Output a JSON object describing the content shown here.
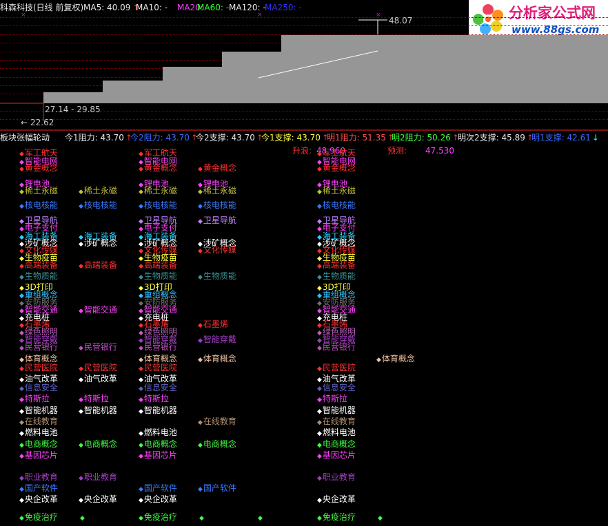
{
  "header": {
    "title": "科森科技(日线 前复权)",
    "items": [
      {
        "label": "MA5: 40.09",
        "color": "#e8e8e8",
        "arrow": "↑",
        "arrow_color": "#ff3333"
      },
      {
        "label": "MA10: -",
        "color": "#e8e8e8",
        "arrow": "",
        "arrow_color": ""
      },
      {
        "label": "MA20: -",
        "color": "#ff40ff",
        "arrow": "",
        "arrow_color": ""
      },
      {
        "label": "MA60: -",
        "color": "#30ff30",
        "arrow": "",
        "arrow_color": ""
      },
      {
        "label": "MA120: -",
        "color": "#e8e8e8",
        "arrow": "",
        "arrow_color": ""
      },
      {
        "label": "MA250: -",
        "color": "#3030ff",
        "arrow": "",
        "arrow_color": ""
      }
    ]
  },
  "logo": {
    "title": "分析家公式网",
    "url": "www.88gs.com"
  },
  "chart_labels": {
    "high": "48.07",
    "range": "27.14 - 29.85",
    "low": "22.62",
    "low_arrow": "←"
  },
  "indicator_bar": {
    "name": "板块张幅轮动",
    "items": [
      {
        "label": "今1阻力: 43.70",
        "color": "#e8e8e8",
        "arrow": "↑",
        "arrow_color": "#ff3333"
      },
      {
        "label": "今2阻力: 43.70",
        "color": "#3a6bff",
        "arrow": "↑",
        "arrow_color": "#ff3333"
      },
      {
        "label": "今2支撑: 43.70",
        "color": "#e8e8e8",
        "arrow": "↑",
        "arrow_color": "#ff3333"
      },
      {
        "label": "今1支撑: 43.70",
        "color": "#ffff40",
        "arrow": "↑",
        "arrow_color": "#ff3333"
      },
      {
        "label": "明1阻力: 51.35",
        "color": "#ff5050",
        "arrow": "↑",
        "arrow_color": "#ff3333"
      },
      {
        "label": "明2阻力: 50.26",
        "color": "#40ff40",
        "arrow": "↑",
        "arrow_color": "#ff3333"
      },
      {
        "label": "明次2支撑: 45.89",
        "color": "#e8e8e8",
        "arrow": "↑",
        "arrow_color": "#ff3333"
      },
      {
        "label": "明1支撑: 42.61",
        "color": "#3a6bff",
        "arrow": "↓",
        "arrow_color": "#00ffff"
      }
    ]
  },
  "annotations": {
    "rise_label": "升浪:",
    "rise_value": "48.960",
    "predict_label": "预测:",
    "predict_value": "47.530"
  },
  "sectors": [
    {
      "name": "军工航天",
      "color": "#ff3333"
    },
    {
      "name": "智能电网",
      "color": "#ff40ff"
    },
    {
      "name": "黄金概念",
      "color": "#ff3030"
    },
    {
      "name": "锂电池",
      "color": "#ff40ff"
    },
    {
      "name": "稀土永磁",
      "color": "#c0c040"
    },
    {
      "name": "核电核能",
      "color": "#3a7bff"
    },
    {
      "name": "卫星导航",
      "color": "#c080ff"
    },
    {
      "name": "电子支付",
      "color": "#ff40ff"
    },
    {
      "name": "海工装备",
      "color": "#30d0ff"
    },
    {
      "name": "涉矿概念",
      "color": "#ffffff"
    },
    {
      "name": "文化传媒",
      "color": "#ff3030"
    },
    {
      "name": "生物疫苗",
      "color": "#ffff40"
    },
    {
      "name": "高端装备",
      "color": "#ff3030"
    },
    {
      "name": "生物质能",
      "color": "#3a9090"
    },
    {
      "name": "3D打印",
      "color": "#ffff40"
    },
    {
      "name": "重组概念",
      "color": "#30c0ff"
    },
    {
      "name": "安防服务",
      "color": "#707070"
    },
    {
      "name": "智能交通",
      "color": "#ff40ff"
    },
    {
      "name": "充电桩",
      "color": "#ffffff"
    },
    {
      "name": "石墨烯",
      "color": "#ff3030"
    },
    {
      "name": "绿色照明",
      "color": "#c060c0"
    },
    {
      "name": "智能穿戴",
      "color": "#a040c0"
    },
    {
      "name": "民营银行",
      "color": "#c050c0"
    },
    {
      "name": "体育概念",
      "color": "#f0c0a0"
    },
    {
      "name": "民营医院",
      "color": "#ff3030"
    },
    {
      "name": "油气改革",
      "color": "#ffffff"
    },
    {
      "name": "信息安全",
      "color": "#6060c0"
    },
    {
      "name": "特斯拉",
      "color": "#ff40ff"
    },
    {
      "name": "智能机器",
      "color": "#ffffff"
    },
    {
      "name": "在线教育",
      "color": "#b09070"
    },
    {
      "name": "燃料电池",
      "color": "#ffffff"
    },
    {
      "name": "电商概念",
      "color": "#40ff40"
    },
    {
      "name": "基因芯片",
      "color": "#ff40ff"
    },
    {
      "name": "职业教育",
      "color": "#a040c0"
    },
    {
      "name": "国产软件",
      "color": "#3a7bff"
    },
    {
      "name": "央企改革",
      "color": "#ffffff"
    },
    {
      "name": "免疫治疗",
      "color": "#40ff40"
    }
  ]
}
